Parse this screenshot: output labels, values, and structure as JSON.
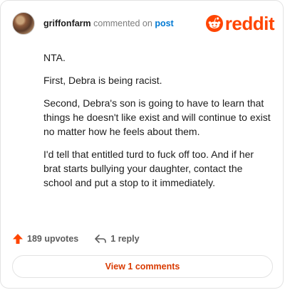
{
  "comment": {
    "username": "griffonfarm",
    "commented_on": "commented on",
    "post_link": "post",
    "paragraphs": [
      "NTA.",
      "First, Debra is being racist.",
      "Second, Debra's son is going to have to learn that things he doesn't like exist and will continue to exist no matter how he feels about them.",
      "I'd tell that entitled turd to fuck off too. And if her brat starts bullying your daughter, contact the school and put a stop to it immediately."
    ],
    "upvotes": "189 upvotes",
    "replies": "1 reply",
    "view_button": "View 1 comments"
  },
  "brand": {
    "wordmark": "reddit",
    "color": "#ff4500"
  },
  "icons": {
    "upvote": "upvote-arrow-icon",
    "reply": "reply-arrow-icon",
    "logo": "reddit-snoo-icon"
  }
}
